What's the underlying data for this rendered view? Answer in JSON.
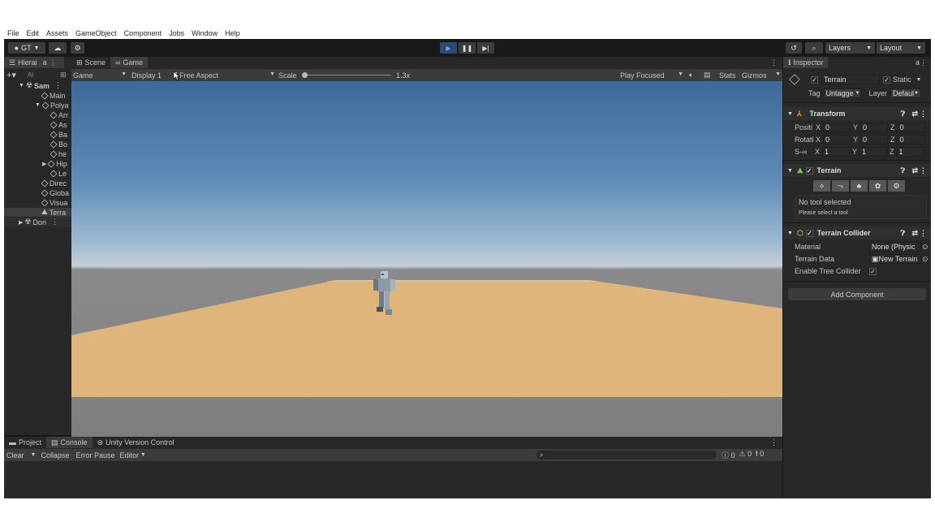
{
  "menu": [
    "File",
    "Edit",
    "Assets",
    "GameObject",
    "Component",
    "Jobs",
    "Window",
    "Help"
  ],
  "toolbar": {
    "account": "GT",
    "layers": "Layers",
    "layout": "Layout"
  },
  "hierarchy": {
    "tab": "Hierai",
    "search_placeholder": "Al",
    "items": [
      {
        "label": "Sam",
        "depth": 0
      },
      {
        "label": "Main",
        "depth": 1
      },
      {
        "label": "Polya",
        "depth": 1
      },
      {
        "label": "Arr",
        "depth": 2
      },
      {
        "label": "As",
        "depth": 2
      },
      {
        "label": "Ba",
        "depth": 2
      },
      {
        "label": "Bo",
        "depth": 2
      },
      {
        "label": "he",
        "depth": 2
      },
      {
        "label": "Hip",
        "depth": 2
      },
      {
        "label": "Le",
        "depth": 2
      },
      {
        "label": "Direc",
        "depth": 1
      },
      {
        "label": "Globa",
        "depth": 1
      },
      {
        "label": "Visua",
        "depth": 1
      },
      {
        "label": "Terra",
        "depth": 1
      },
      {
        "label": "Don",
        "depth": 0
      }
    ]
  },
  "game_view": {
    "tabs": [
      "Scene",
      "Game"
    ],
    "mode": "Game",
    "display": "Display 1",
    "aspect": "Free Aspect",
    "scale_label": "Scale",
    "scale_value": "1.3x",
    "play_focused": "Play Focused",
    "stats": "Stats",
    "gizmos": "Gizmos"
  },
  "inspector": {
    "tab": "Inspector",
    "object_name": "Terrain",
    "static_label": "Static",
    "tag_label": "Tag",
    "tag_value": "Untagge",
    "layer_label": "Layer",
    "layer_value": "Defaul",
    "transform": {
      "title": "Transform",
      "rows": [
        {
          "label": "Positi",
          "x": "0",
          "y": "0",
          "z": "0"
        },
        {
          "label": "Rotati",
          "x": "0",
          "y": "0",
          "z": "0"
        },
        {
          "label": "S",
          "x": "1",
          "y": "1",
          "z": "1"
        }
      ]
    },
    "terrain": {
      "title": "Terrain",
      "no_tool": "No tool selected",
      "hint": "Please select a tool"
    },
    "collider": {
      "title": "Terrain Collider",
      "material_label": "Material",
      "material_value": "None (Physic",
      "data_label": "Terrain Data",
      "data_value": "New Terrain",
      "tree_label": "Enable Tree Collider"
    },
    "add_component": "Add Component"
  },
  "console": {
    "tabs": [
      "Project",
      "Console",
      "Unity Version Control"
    ],
    "clear": "Clear",
    "collapse": "Collapse",
    "error_pause": "Error Pause",
    "editor": "Editor",
    "counts": {
      "info": "0",
      "warn": "0",
      "error": "0"
    }
  }
}
